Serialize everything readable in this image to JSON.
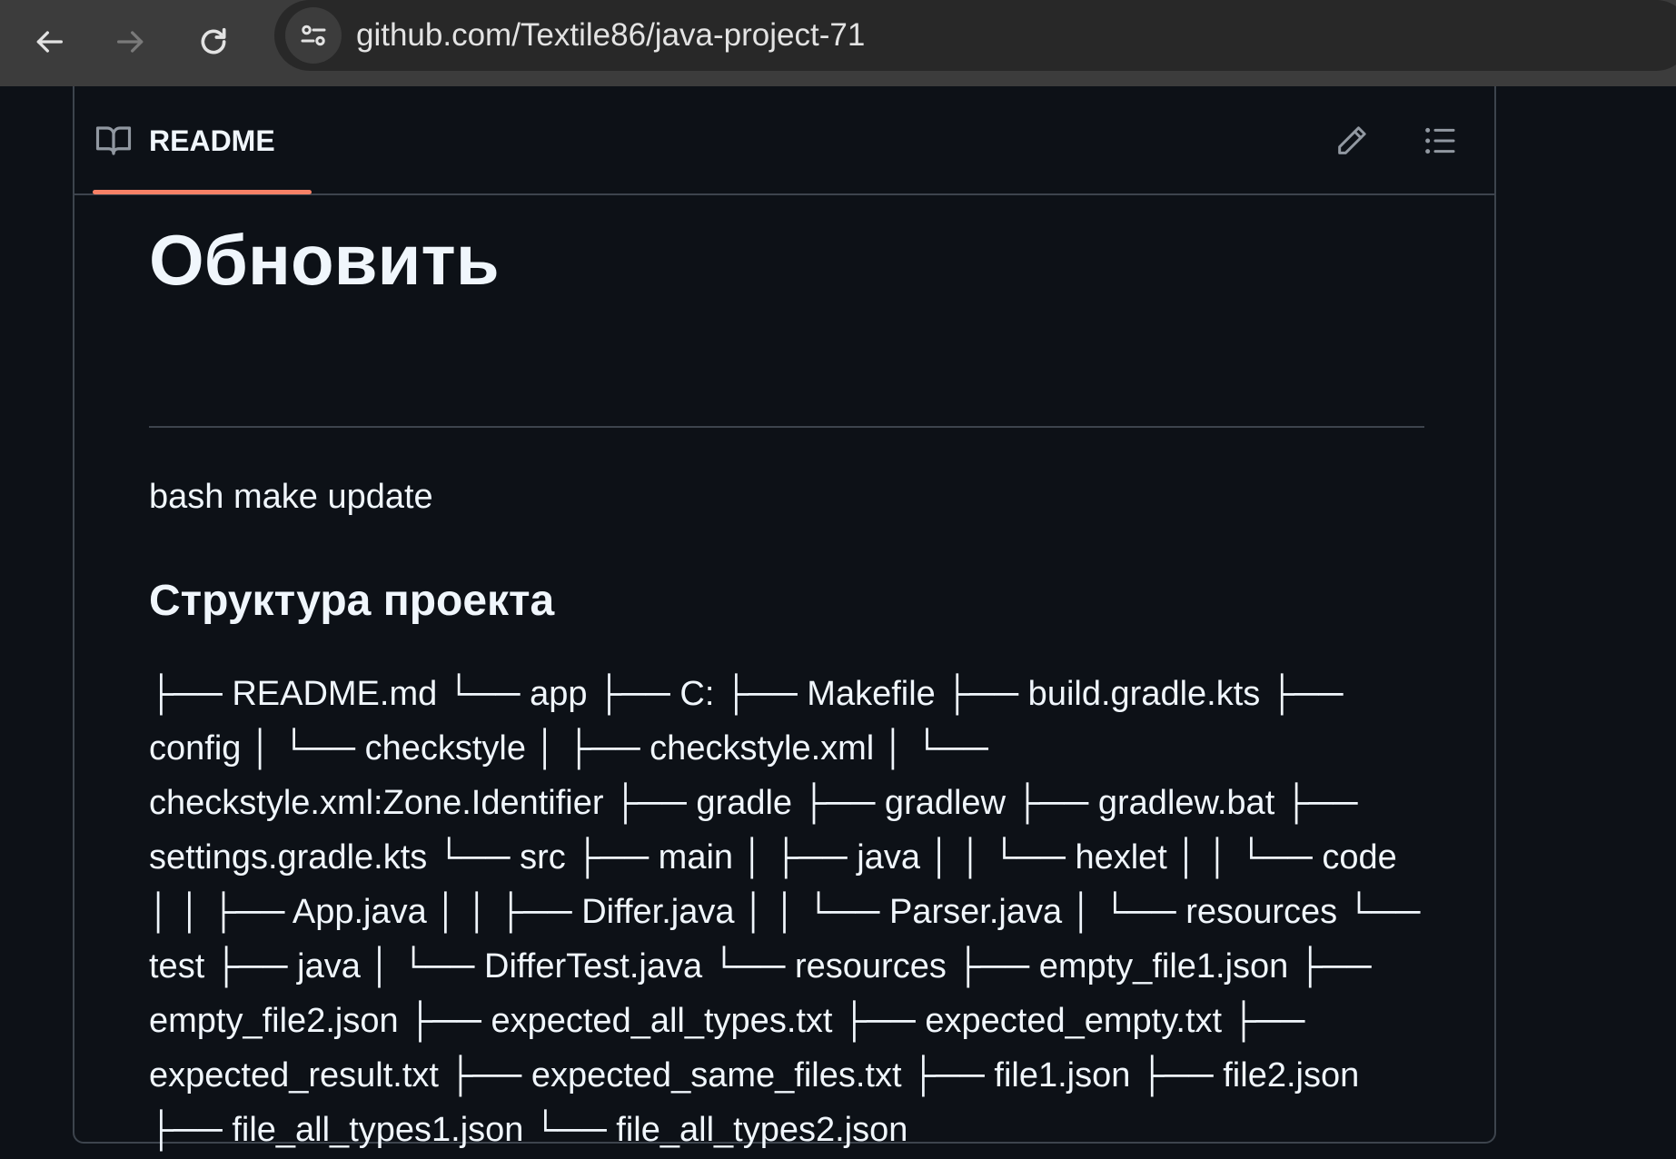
{
  "browser": {
    "url": "github.com/Textile86/java-project-71",
    "back_icon": "arrow-left-icon",
    "forward_icon": "arrow-right-icon",
    "reload_icon": "reload-icon",
    "site_info_icon": "tune-icon"
  },
  "readme": {
    "tab_label": "README",
    "tab_icon": "book-icon",
    "edit_icon": "pencil-icon",
    "toc_icon": "list-unordered-icon",
    "accent_color": "#f78166"
  },
  "content": {
    "h1": "Обновить",
    "paragraph": "bash make update",
    "h2": "Структура проекта",
    "tree": "├── README.md └── app ├── C: ├── Makefile ├── build.gradle.kts ├── config │ └── checkstyle │ ├── checkstyle.xml │ └── checkstyle.xml:Zone.Identifier ├── gradle ├── gradlew ├── gradlew.bat ├── settings.gradle.kts └── src ├── main │ ├── java │ │ └── hexlet │ │ └── code │ │ ├── App.java │ │ ├── Differ.java │ │ └── Parser.java │ └── resources └── test ├── java │ └── DifferTest.java └── resources ├── empty_file1.json ├── empty_file2.json ├── expected_all_types.txt ├── expected_empty.txt ├── expected_result.txt ├── expected_same_files.txt ├── file1.json ├── file2.json ├── file_all_types1.json └── file_all_types2.json"
  }
}
